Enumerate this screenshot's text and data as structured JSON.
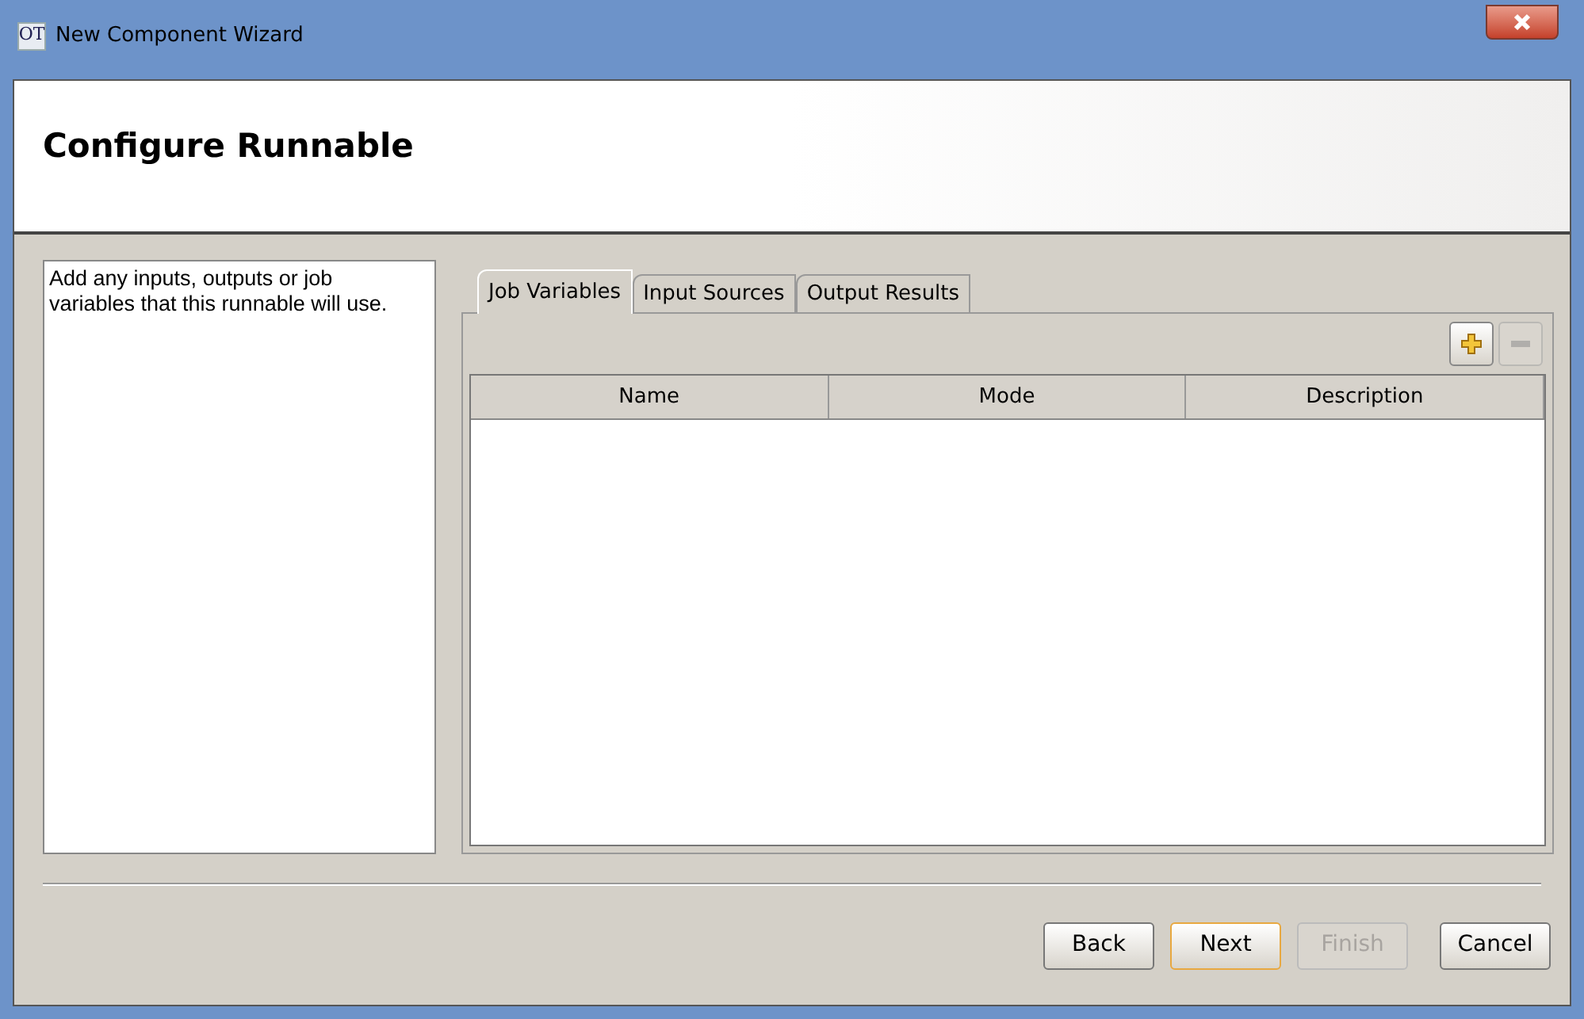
{
  "window": {
    "title": "New Component Wizard",
    "app_icon": "OT"
  },
  "header": {
    "title": "Configure Runnable"
  },
  "description": "Add any inputs, outputs or job variables that this runnable will use.",
  "tabs": [
    {
      "label": "Job Variables",
      "selected": true
    },
    {
      "label": "Input Sources",
      "selected": false
    },
    {
      "label": "Output Results",
      "selected": false
    }
  ],
  "toolbar": [
    {
      "kind": "add",
      "disabled": false
    },
    {
      "kind": "remove",
      "disabled": true
    }
  ],
  "table": {
    "columns": [
      "Name",
      "Mode",
      "Description"
    ]
  },
  "buttons": [
    {
      "label": "Back",
      "default": false,
      "disabled": false
    },
    {
      "label": "Next",
      "default": true,
      "disabled": false
    },
    {
      "label": "Finish",
      "default": false,
      "disabled": true
    },
    {
      "label": "Cancel",
      "default": false,
      "disabled": false
    }
  ]
}
